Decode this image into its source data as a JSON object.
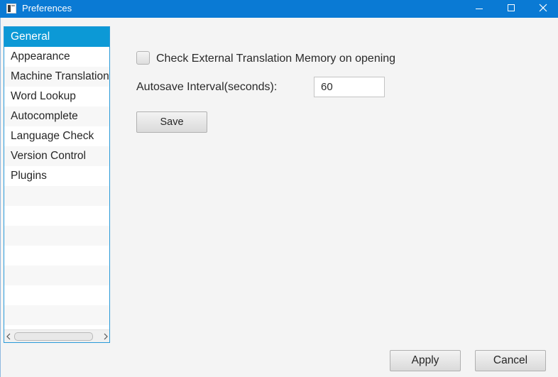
{
  "window": {
    "title": "Preferences",
    "icons": {
      "app": "app-window-icon",
      "minimize": "minimize-icon",
      "maximize": "maximize-icon",
      "close": "close-icon"
    },
    "colors": {
      "titlebar": "#0a7ad4",
      "selection": "#0c99d6",
      "list_border": "#2a9ad8"
    }
  },
  "sidebar": {
    "items": [
      {
        "label": "General",
        "selected": true
      },
      {
        "label": "Appearance",
        "selected": false
      },
      {
        "label": "Machine Translation",
        "selected": false
      },
      {
        "label": "Word Lookup",
        "selected": false
      },
      {
        "label": "Autocomplete",
        "selected": false
      },
      {
        "label": "Language Check",
        "selected": false
      },
      {
        "label": "Version Control",
        "selected": false
      },
      {
        "label": "Plugins",
        "selected": false
      }
    ]
  },
  "general": {
    "check_external_tm": {
      "label": "Check External Translation Memory on opening",
      "checked": false
    },
    "autosave": {
      "label": "Autosave Interval(seconds):",
      "value": "60"
    },
    "save_label": "Save"
  },
  "footer": {
    "apply_label": "Apply",
    "cancel_label": "Cancel"
  }
}
